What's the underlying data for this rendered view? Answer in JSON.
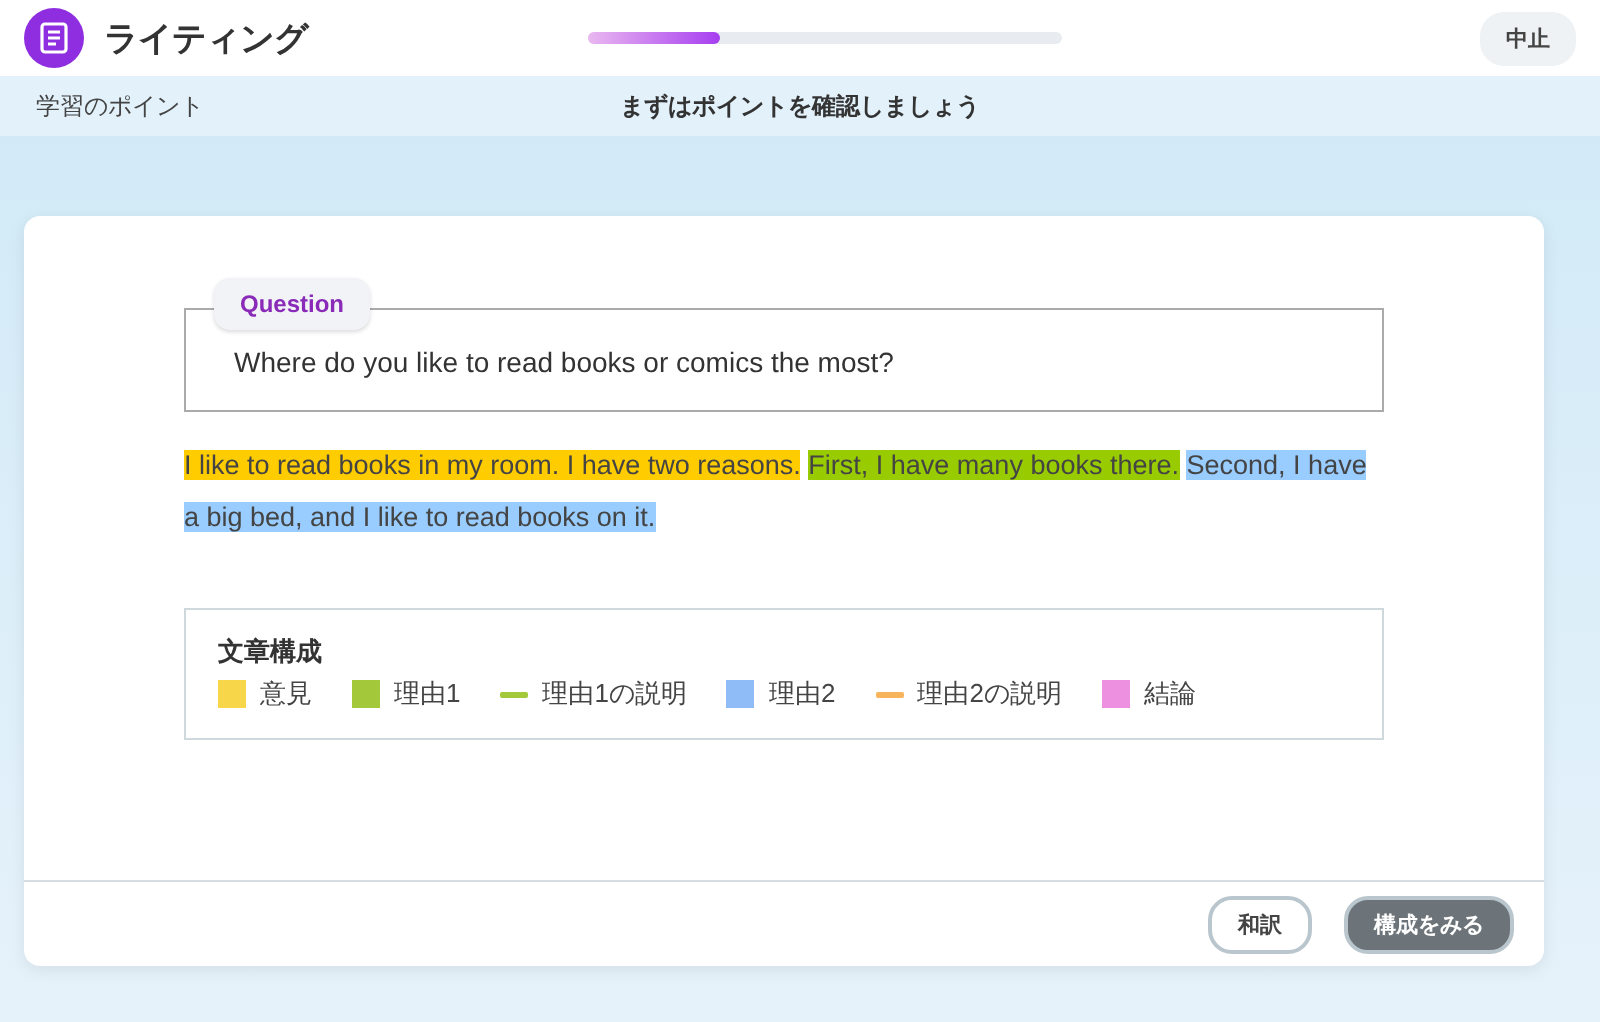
{
  "header": {
    "title": "ライティング",
    "progress": {
      "level": 0.28
    },
    "quit_button": "中止"
  },
  "subheader": {
    "left": "学習のポイント",
    "center": "まずはポイントを確認しましょう"
  },
  "question": {
    "tag": "Question",
    "text": "Where do you like to read books or comics the most?"
  },
  "answer": [
    {
      "text": "I like to read books in my room. I have two reasons.",
      "color": "#ffcc00"
    },
    {
      "text": "First, I have many books there.",
      "color": "#99cc00"
    },
    {
      "text": "Second, I have a big bed, and I like to read books on it.",
      "color": "#99ccff"
    }
  ],
  "legend": {
    "title": "文章構成",
    "items": [
      {
        "label": "意見",
        "kind": "swatch",
        "color": "#f7d64a"
      },
      {
        "label": "理由1",
        "kind": "swatch",
        "color": "#a3c93a"
      },
      {
        "label": "理由1の説明",
        "kind": "line",
        "color": "#a3c93a"
      },
      {
        "label": "理由2",
        "kind": "swatch",
        "color": "#8fbcf7"
      },
      {
        "label": "理由2の説明",
        "kind": "line",
        "color": "#f7b45a"
      },
      {
        "label": "結論",
        "kind": "swatch",
        "color": "#ee90e0"
      }
    ]
  },
  "footer": {
    "buttons": [
      {
        "label": "和訳",
        "kind": "outline"
      },
      {
        "label": "構成をみる",
        "kind": "filled"
      }
    ]
  }
}
